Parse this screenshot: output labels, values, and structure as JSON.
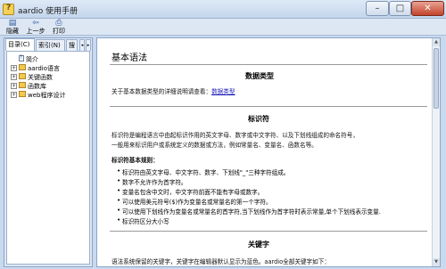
{
  "window": {
    "title": "aardio 使用手册",
    "min_glyph": "–",
    "max_glyph": "□",
    "close_glyph": "✕"
  },
  "toolbar": {
    "hide_label": "隐藏",
    "back_label": "上一步",
    "print_label": "打印",
    "hide_icon": "hide-pane-icon",
    "back_icon": "back-arrow-icon",
    "print_icon": "printer-icon"
  },
  "nav": {
    "tabs": [
      {
        "label": "目录(C)"
      },
      {
        "label": "索引(N)"
      },
      {
        "label": "搜"
      }
    ],
    "tree": [
      {
        "label": "简介",
        "type": "page"
      },
      {
        "label": "aardio语言",
        "type": "book"
      },
      {
        "label": "关键函数",
        "type": "book"
      },
      {
        "label": "函数库",
        "type": "book"
      },
      {
        "label": "web程序设计",
        "type": "book"
      }
    ]
  },
  "content": {
    "page_title": "基本语法",
    "sections": {
      "datatypes": {
        "heading": "数据类型",
        "text": "关于基本数据类型的详细说明请查看：",
        "link": "数据类型"
      },
      "identifier": {
        "heading": "标识符",
        "para1": "标识符是编程语言中由起标识作用的英文字母、数字或中文字符、以及下划线组成的命名符号，",
        "para2": "一般用来标识用户或系统定义的数据或方法，例如常量名、变量名、函数名等。",
        "rules_heading": "标识符基本规则：",
        "rules": [
          "标识符由英文字母、中文字符、数字、下划线\"_\"三种字符组成。",
          "数字不允许作为首字符。",
          "变量名包含中文时，中文字符前面不能有字母或数字。",
          "可以使用美元符号($)作为变量名或常量名的第一个字符。",
          "可以使用下划线作为变量名或常量名的首字符,当下划线作为首字符时表示常量,单个下划线表示变量.",
          "标识符区分大小写"
        ]
      },
      "keywords": {
        "heading": "关键字",
        "text": "语法系统保留的关键字，关键字在编辑器默认显示为蓝色。aardio全部关键字如下："
      }
    }
  }
}
